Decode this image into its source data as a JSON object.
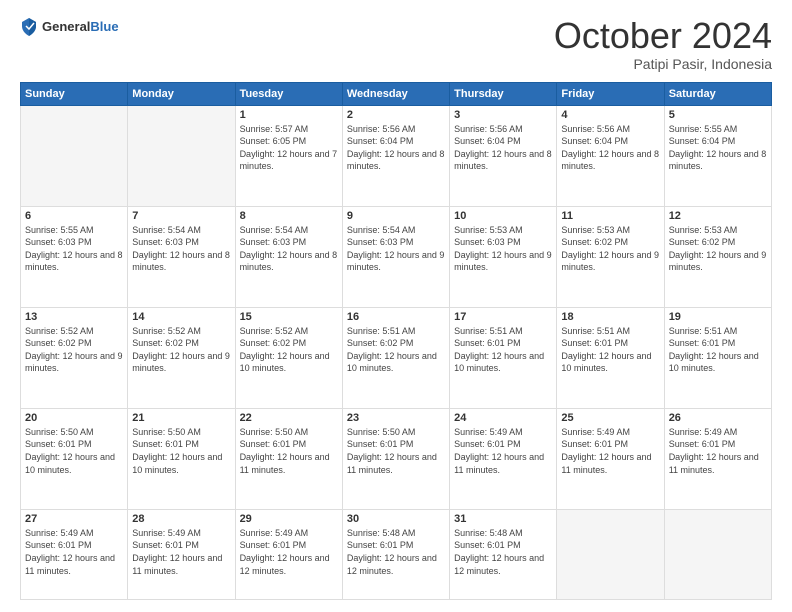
{
  "header": {
    "logo_line1": "General",
    "logo_line2": "Blue",
    "month_title": "October 2024",
    "subtitle": "Patipi Pasir, Indonesia"
  },
  "weekdays": [
    "Sunday",
    "Monday",
    "Tuesday",
    "Wednesday",
    "Thursday",
    "Friday",
    "Saturday"
  ],
  "weeks": [
    [
      {
        "day": "",
        "empty": true
      },
      {
        "day": "",
        "empty": true
      },
      {
        "day": "1",
        "sunrise": "5:57 AM",
        "sunset": "6:05 PM",
        "daylight": "12 hours and 7 minutes."
      },
      {
        "day": "2",
        "sunrise": "5:56 AM",
        "sunset": "6:04 PM",
        "daylight": "12 hours and 8 minutes."
      },
      {
        "day": "3",
        "sunrise": "5:56 AM",
        "sunset": "6:04 PM",
        "daylight": "12 hours and 8 minutes."
      },
      {
        "day": "4",
        "sunrise": "5:56 AM",
        "sunset": "6:04 PM",
        "daylight": "12 hours and 8 minutes."
      },
      {
        "day": "5",
        "sunrise": "5:55 AM",
        "sunset": "6:04 PM",
        "daylight": "12 hours and 8 minutes."
      }
    ],
    [
      {
        "day": "6",
        "sunrise": "5:55 AM",
        "sunset": "6:03 PM",
        "daylight": "12 hours and 8 minutes."
      },
      {
        "day": "7",
        "sunrise": "5:54 AM",
        "sunset": "6:03 PM",
        "daylight": "12 hours and 8 minutes."
      },
      {
        "day": "8",
        "sunrise": "5:54 AM",
        "sunset": "6:03 PM",
        "daylight": "12 hours and 8 minutes."
      },
      {
        "day": "9",
        "sunrise": "5:54 AM",
        "sunset": "6:03 PM",
        "daylight": "12 hours and 9 minutes."
      },
      {
        "day": "10",
        "sunrise": "5:53 AM",
        "sunset": "6:03 PM",
        "daylight": "12 hours and 9 minutes."
      },
      {
        "day": "11",
        "sunrise": "5:53 AM",
        "sunset": "6:02 PM",
        "daylight": "12 hours and 9 minutes."
      },
      {
        "day": "12",
        "sunrise": "5:53 AM",
        "sunset": "6:02 PM",
        "daylight": "12 hours and 9 minutes."
      }
    ],
    [
      {
        "day": "13",
        "sunrise": "5:52 AM",
        "sunset": "6:02 PM",
        "daylight": "12 hours and 9 minutes."
      },
      {
        "day": "14",
        "sunrise": "5:52 AM",
        "sunset": "6:02 PM",
        "daylight": "12 hours and 9 minutes."
      },
      {
        "day": "15",
        "sunrise": "5:52 AM",
        "sunset": "6:02 PM",
        "daylight": "12 hours and 10 minutes."
      },
      {
        "day": "16",
        "sunrise": "5:51 AM",
        "sunset": "6:02 PM",
        "daylight": "12 hours and 10 minutes."
      },
      {
        "day": "17",
        "sunrise": "5:51 AM",
        "sunset": "6:01 PM",
        "daylight": "12 hours and 10 minutes."
      },
      {
        "day": "18",
        "sunrise": "5:51 AM",
        "sunset": "6:01 PM",
        "daylight": "12 hours and 10 minutes."
      },
      {
        "day": "19",
        "sunrise": "5:51 AM",
        "sunset": "6:01 PM",
        "daylight": "12 hours and 10 minutes."
      }
    ],
    [
      {
        "day": "20",
        "sunrise": "5:50 AM",
        "sunset": "6:01 PM",
        "daylight": "12 hours and 10 minutes."
      },
      {
        "day": "21",
        "sunrise": "5:50 AM",
        "sunset": "6:01 PM",
        "daylight": "12 hours and 10 minutes."
      },
      {
        "day": "22",
        "sunrise": "5:50 AM",
        "sunset": "6:01 PM",
        "daylight": "12 hours and 11 minutes."
      },
      {
        "day": "23",
        "sunrise": "5:50 AM",
        "sunset": "6:01 PM",
        "daylight": "12 hours and 11 minutes."
      },
      {
        "day": "24",
        "sunrise": "5:49 AM",
        "sunset": "6:01 PM",
        "daylight": "12 hours and 11 minutes."
      },
      {
        "day": "25",
        "sunrise": "5:49 AM",
        "sunset": "6:01 PM",
        "daylight": "12 hours and 11 minutes."
      },
      {
        "day": "26",
        "sunrise": "5:49 AM",
        "sunset": "6:01 PM",
        "daylight": "12 hours and 11 minutes."
      }
    ],
    [
      {
        "day": "27",
        "sunrise": "5:49 AM",
        "sunset": "6:01 PM",
        "daylight": "12 hours and 11 minutes."
      },
      {
        "day": "28",
        "sunrise": "5:49 AM",
        "sunset": "6:01 PM",
        "daylight": "12 hours and 11 minutes."
      },
      {
        "day": "29",
        "sunrise": "5:49 AM",
        "sunset": "6:01 PM",
        "daylight": "12 hours and 12 minutes."
      },
      {
        "day": "30",
        "sunrise": "5:48 AM",
        "sunset": "6:01 PM",
        "daylight": "12 hours and 12 minutes."
      },
      {
        "day": "31",
        "sunrise": "5:48 AM",
        "sunset": "6:01 PM",
        "daylight": "12 hours and 12 minutes."
      },
      {
        "day": "",
        "empty": true
      },
      {
        "day": "",
        "empty": true
      }
    ]
  ]
}
